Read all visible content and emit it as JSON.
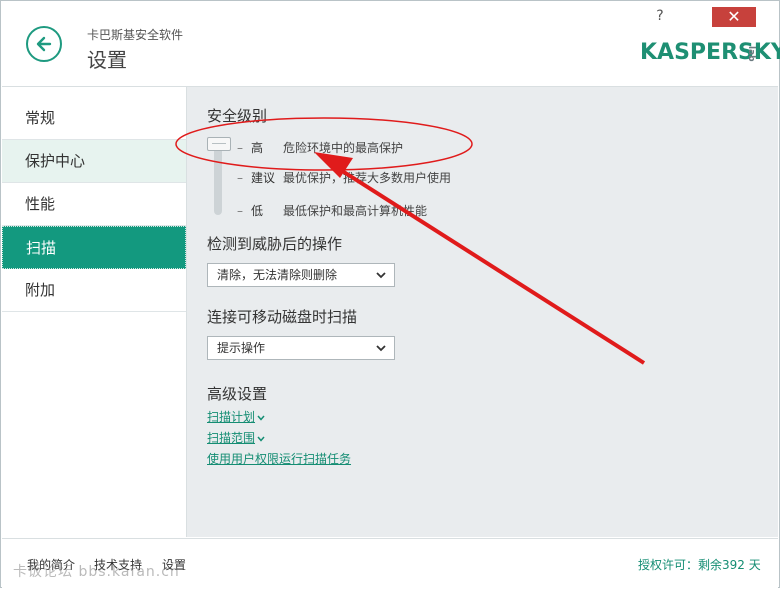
{
  "header": {
    "app_name": "卡巴斯基安全软件",
    "page_title": "设置",
    "help_label": "?",
    "close_label": "✕",
    "logo_text": "KASPERSKY",
    "logo_suffix": "lab"
  },
  "sidebar": {
    "items": [
      {
        "label": "常规"
      },
      {
        "label": "保护中心"
      },
      {
        "label": "性能"
      },
      {
        "label": "扫描"
      },
      {
        "label": "附加"
      }
    ]
  },
  "security_level": {
    "title": "安全级别",
    "levels": [
      {
        "dash": "–",
        "name": "高",
        "desc": "危险环境中的最高保护"
      },
      {
        "dash": "–",
        "name": "建议",
        "desc": "最优保护，推荐大多数用户使用"
      },
      {
        "dash": "–",
        "name": "低",
        "desc": "最低保护和最高计算机性能"
      }
    ]
  },
  "threat_action": {
    "title": "检测到威胁后的操作",
    "selected": "清除，无法清除则删除"
  },
  "removable_scan": {
    "title": "连接可移动磁盘时扫描",
    "selected": "提示操作"
  },
  "advanced": {
    "title": "高级设置",
    "links": [
      {
        "label": "扫描计划"
      },
      {
        "label": "扫描范围"
      },
      {
        "label": "使用用户权限运行扫描任务"
      }
    ]
  },
  "footer": {
    "links": [
      {
        "label": "我的简介"
      },
      {
        "label": "技术支持"
      },
      {
        "label": "设置"
      }
    ],
    "license": "授权许可：剩余392 天"
  },
  "watermark": "卡饭论坛 bbs.kafan.cn",
  "colors": {
    "accent": "#13997f",
    "link": "#148d73",
    "close": "#c7413c",
    "annotation": "#e01b1b"
  }
}
